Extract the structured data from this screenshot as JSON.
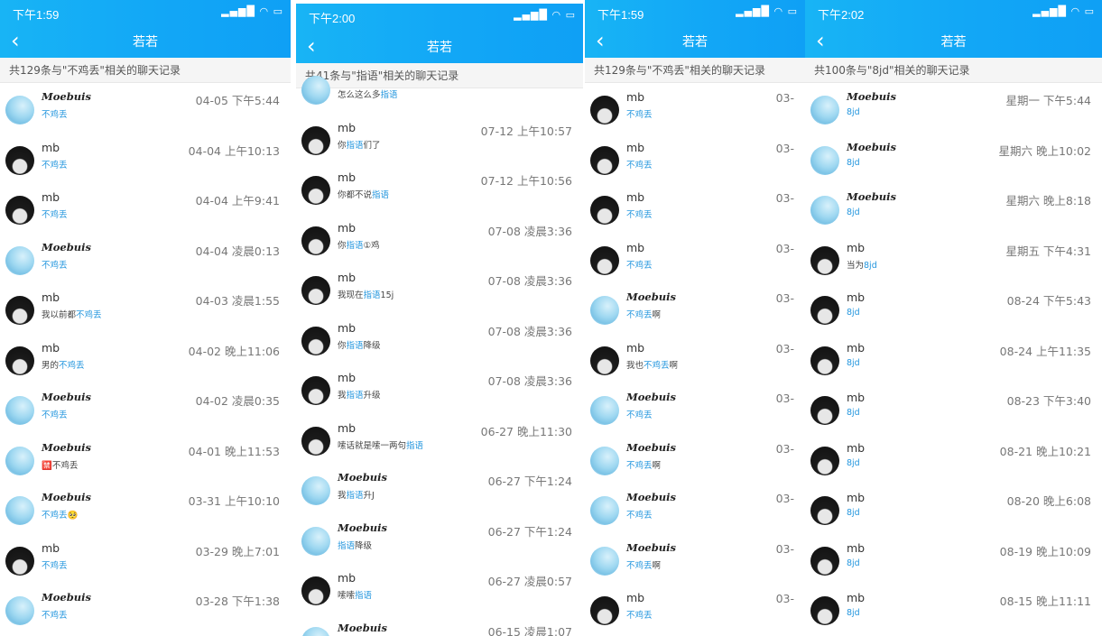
{
  "title_text": "若若",
  "panels": [
    {
      "time": "下午1:59",
      "summary": "共129条与\"不鸡丢\"相关的聊天记录",
      "rows": [
        {
          "avatar": "anime",
          "name": "Moebuis",
          "pre": "",
          "hl": "不鸡丢",
          "post": "",
          "time": "04-05 下午5:44"
        },
        {
          "avatar": "dark",
          "name": "mb",
          "pre": "",
          "hl": "不鸡丢",
          "post": "",
          "time": "04-04 上午10:13"
        },
        {
          "avatar": "dark",
          "name": "mb",
          "pre": "",
          "hl": "不鸡丢",
          "post": "",
          "time": "04-04 上午9:41"
        },
        {
          "avatar": "anime",
          "name": "Moebuis",
          "pre": "",
          "hl": "不鸡丢",
          "post": "",
          "time": "04-04 凌晨0:13"
        },
        {
          "avatar": "dark",
          "name": "mb",
          "pre": "我以前都",
          "hl": "不鸡丢",
          "post": "",
          "time": "04-03 凌晨1:55"
        },
        {
          "avatar": "dark",
          "name": "mb",
          "pre": "男的",
          "hl": "不鸡丢",
          "post": "",
          "time": "04-02 晚上11:06"
        },
        {
          "avatar": "anime",
          "name": "Moebuis",
          "pre": "",
          "hl": "不鸡丢",
          "post": "",
          "time": "04-02 凌晨0:35"
        },
        {
          "avatar": "anime",
          "name": "Moebuis",
          "pre": "🈲",
          "hl": "",
          "post": "不鸡丢",
          "time": "04-01 晚上11:53"
        },
        {
          "avatar": "anime",
          "name": "Moebuis",
          "pre": "",
          "hl": "不鸡丢",
          "post": "🥺",
          "time": "03-31 上午10:10"
        },
        {
          "avatar": "dark",
          "name": "mb",
          "pre": "",
          "hl": "不鸡丢",
          "post": "",
          "time": "03-29 晚上7:01"
        },
        {
          "avatar": "anime",
          "name": "Moebuis",
          "pre": "",
          "hl": "不鸡丢",
          "post": "",
          "time": "03-28 下午1:38"
        }
      ]
    },
    {
      "time": "下午2:00",
      "summary": "共41条与\"指语\"相关的聊天记录",
      "rows": [
        {
          "avatar": "anime",
          "name": "",
          "pre": "怎么这么多",
          "hl": "指语",
          "post": "",
          "time": ""
        },
        {
          "avatar": "dark",
          "name": "mb",
          "pre": "你",
          "hl": "指语",
          "post": "们了",
          "time": "07-12 上午10:57"
        },
        {
          "avatar": "dark",
          "name": "mb",
          "pre": "你都不说",
          "hl": "指语",
          "post": "",
          "time": "07-12 上午10:56"
        },
        {
          "avatar": "dark",
          "name": "mb",
          "pre": "你",
          "hl": "指语",
          "post": "①鸡",
          "time": "07-08 凌晨3:36"
        },
        {
          "avatar": "dark",
          "name": "mb",
          "pre": "我现在",
          "hl": "指语",
          "post": "15j",
          "time": "07-08 凌晨3:36"
        },
        {
          "avatar": "dark",
          "name": "mb",
          "pre": "你",
          "hl": "指语",
          "post": "降级",
          "time": "07-08 凌晨3:36"
        },
        {
          "avatar": "dark",
          "name": "mb",
          "pre": "我",
          "hl": "指语",
          "post": "升级",
          "time": "07-08 凌晨3:36"
        },
        {
          "avatar": "dark",
          "name": "mb",
          "pre": "嗦话就是嗦一两句",
          "hl": "指语",
          "post": "",
          "time": "06-27 晚上11:30"
        },
        {
          "avatar": "anime",
          "name": "Moebuis",
          "pre": "我",
          "hl": "指语",
          "post": "升J",
          "time": "06-27 下午1:24"
        },
        {
          "avatar": "anime",
          "name": "Moebuis",
          "pre": "",
          "hl": "指语",
          "post": "降级",
          "time": "06-27 下午1:24"
        },
        {
          "avatar": "dark",
          "name": "mb",
          "pre": "嗦嗦",
          "hl": "指语",
          "post": "",
          "time": "06-27 凌晨0:57"
        },
        {
          "avatar": "anime",
          "name": "Moebuis",
          "pre": "",
          "hl": "",
          "post": "",
          "time": "06-15 凌晨1:07"
        }
      ]
    },
    {
      "time": "下午1:59",
      "summary": "共129条与\"不鸡丢\"相关的聊天记录",
      "rows": [
        {
          "avatar": "dark",
          "name": "mb",
          "pre": "",
          "hl": "不鸡丢",
          "post": "",
          "time": "03-"
        },
        {
          "avatar": "dark",
          "name": "mb",
          "pre": "",
          "hl": "不鸡丢",
          "post": "",
          "time": "03-"
        },
        {
          "avatar": "dark",
          "name": "mb",
          "pre": "",
          "hl": "不鸡丢",
          "post": "",
          "time": "03-"
        },
        {
          "avatar": "dark",
          "name": "mb",
          "pre": "",
          "hl": "不鸡丢",
          "post": "",
          "time": "03-"
        },
        {
          "avatar": "anime",
          "name": "Moebuis",
          "pre": "",
          "hl": "不鸡丢",
          "post": "啊",
          "time": "03-"
        },
        {
          "avatar": "dark",
          "name": "mb",
          "pre": "我也",
          "hl": "不鸡丢",
          "post": "啊",
          "time": "03-"
        },
        {
          "avatar": "anime",
          "name": "Moebuis",
          "pre": "",
          "hl": "不鸡丢",
          "post": "",
          "time": "03-"
        },
        {
          "avatar": "anime",
          "name": "Moebuis",
          "pre": "",
          "hl": "不鸡丢",
          "post": "啊",
          "time": "03-"
        },
        {
          "avatar": "anime",
          "name": "Moebuis",
          "pre": "",
          "hl": "不鸡丢",
          "post": "",
          "time": "03-"
        },
        {
          "avatar": "anime",
          "name": "Moebuis",
          "pre": "",
          "hl": "不鸡丢",
          "post": "啊",
          "time": "03-"
        },
        {
          "avatar": "dark",
          "name": "mb",
          "pre": "",
          "hl": "不鸡丢",
          "post": "",
          "time": "03-"
        }
      ]
    },
    {
      "time": "下午2:02",
      "summary": "共100条与\"8jd\"相关的聊天记录",
      "rows": [
        {
          "avatar": "anime",
          "name": "Moebuis",
          "pre": "",
          "hl": "8jd",
          "post": "",
          "time": "星期一 下午5:44"
        },
        {
          "avatar": "anime",
          "name": "Moebuis",
          "pre": "",
          "hl": "8jd",
          "post": "",
          "time": "星期六 晚上10:02"
        },
        {
          "avatar": "anime",
          "name": "Moebuis",
          "pre": "",
          "hl": "8jd",
          "post": "",
          "time": "星期六 晚上8:18"
        },
        {
          "avatar": "dark",
          "name": "mb",
          "pre": "当为",
          "hl": "8jd",
          "post": "",
          "time": "星期五 下午4:31"
        },
        {
          "avatar": "dark",
          "name": "mb",
          "pre": "",
          "hl": "8jd",
          "post": "",
          "time": "08-24 下午5:43"
        },
        {
          "avatar": "dark",
          "name": "mb",
          "pre": "",
          "hl": "8jd",
          "post": "",
          "time": "08-24 上午11:35"
        },
        {
          "avatar": "dark",
          "name": "mb",
          "pre": "",
          "hl": "8jd",
          "post": "",
          "time": "08-23 下午3:40"
        },
        {
          "avatar": "dark",
          "name": "mb",
          "pre": "",
          "hl": "8jd",
          "post": "",
          "time": "08-21 晚上10:21"
        },
        {
          "avatar": "dark",
          "name": "mb",
          "pre": "",
          "hl": "8jd",
          "post": "",
          "time": "08-20 晚上6:08"
        },
        {
          "avatar": "dark",
          "name": "mb",
          "pre": "",
          "hl": "8jd",
          "post": "",
          "time": "08-19 晚上10:09"
        },
        {
          "avatar": "dark",
          "name": "mb",
          "pre": "",
          "hl": "8jd",
          "post": "",
          "time": "08-15 晚上11:11"
        }
      ]
    }
  ],
  "icons": {
    "back": "back-chevron-icon",
    "signal": "signal-icon",
    "wifi": "wifi-icon",
    "battery": "battery-icon"
  },
  "colors": {
    "header": "#12a7f6",
    "highlight": "#2396de"
  }
}
